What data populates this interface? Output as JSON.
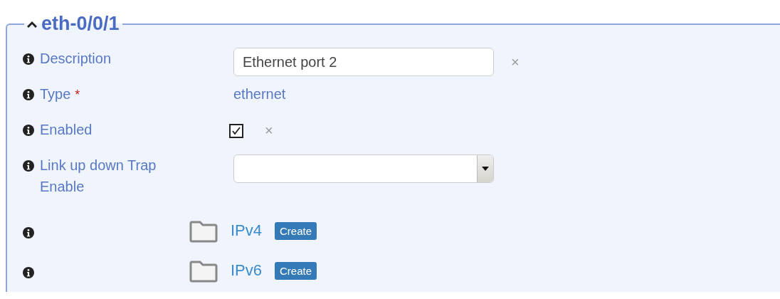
{
  "panel": {
    "title": "eth-0/0/1",
    "expanded": true
  },
  "fields": [
    {
      "kind": "text",
      "label": "Description",
      "value": "Ethernet port 2",
      "clear": "×"
    },
    {
      "kind": "static",
      "label": "Type",
      "required_mark": "*",
      "value": "ethernet"
    },
    {
      "kind": "checkbox",
      "label": "Enabled",
      "checked": true,
      "clear": "×"
    },
    {
      "kind": "select",
      "label": "Link up down Trap Enable"
    },
    {
      "kind": "container",
      "name": "IPv4",
      "action": "Create"
    },
    {
      "kind": "container",
      "name": "IPv6",
      "action": "Create"
    }
  ]
}
